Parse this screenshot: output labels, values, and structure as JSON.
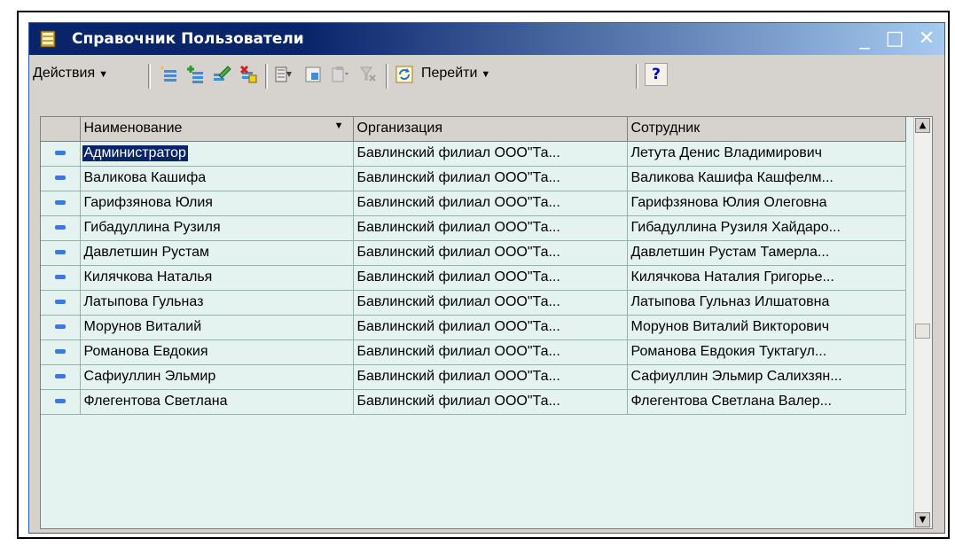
{
  "window": {
    "title": "Справочник Пользователи",
    "minimize": "_",
    "maximize": "□",
    "close": "✕"
  },
  "toolbar": {
    "actions_label": "Действия",
    "goto_label": "Перейти",
    "help_label": "?",
    "icons": [
      "add-item-icon",
      "add-group-icon",
      "edit-icon",
      "delete-icon",
      "filter-icon",
      "folder-icon",
      "copy-icon",
      "clear-filter-icon",
      "refresh-icon"
    ]
  },
  "table": {
    "columns": [
      "Наименование",
      "Организация",
      "Сотрудник"
    ],
    "rows": [
      {
        "name": "Администратор",
        "org": "Бавлинский филиал ООО\"Та...",
        "employee": "Летута Денис Владимирович"
      },
      {
        "name": "Валикова Кашифа",
        "org": "Бавлинский филиал ООО\"Та...",
        "employee": "Валикова Кашифа Кашфелм..."
      },
      {
        "name": "Гарифзянова Юлия",
        "org": "Бавлинский филиал ООО\"Та...",
        "employee": "Гарифзянова Юлия Олеговна"
      },
      {
        "name": "Гибадуллина Рузиля",
        "org": "Бавлинский филиал ООО\"Та...",
        "employee": "Гибадуллина Рузиля Хайдаро..."
      },
      {
        "name": "Давлетшин Рустам",
        "org": "Бавлинский филиал ООО\"Та...",
        "employee": "Давлетшин Рустам Тамерла..."
      },
      {
        "name": "Килячкова Наталья",
        "org": "Бавлинский филиал ООО\"Та...",
        "employee": "Килячкова Наталия Григорье..."
      },
      {
        "name": "Латыпова Гульназ",
        "org": "Бавлинский филиал ООО\"Та...",
        "employee": "Латыпова Гульназ Илшатовна"
      },
      {
        "name": "Морунов Виталий",
        "org": "Бавлинский филиал ООО\"Та...",
        "employee": "Морунов Виталий Викторович"
      },
      {
        "name": "Романова Евдокия",
        "org": "Бавлинский филиал ООО\"Та...",
        "employee": "Романова Евдокия Туктагул..."
      },
      {
        "name": "Сафиуллин Эльмир",
        "org": "Бавлинский филиал ООО\"Та...",
        "employee": "Сафиуллин Эльмир Салихзян..."
      },
      {
        "name": "Флегентова Светлана",
        "org": "Бавлинский филиал ООО\"Та...",
        "employee": "Флегентова Светлана Валер..."
      }
    ],
    "selected_row": 0
  },
  "colors": {
    "title_bar": "#0a246a",
    "row_background": "#e4f3f0",
    "selection": "#0a246a",
    "marker": "#3f78d8"
  }
}
